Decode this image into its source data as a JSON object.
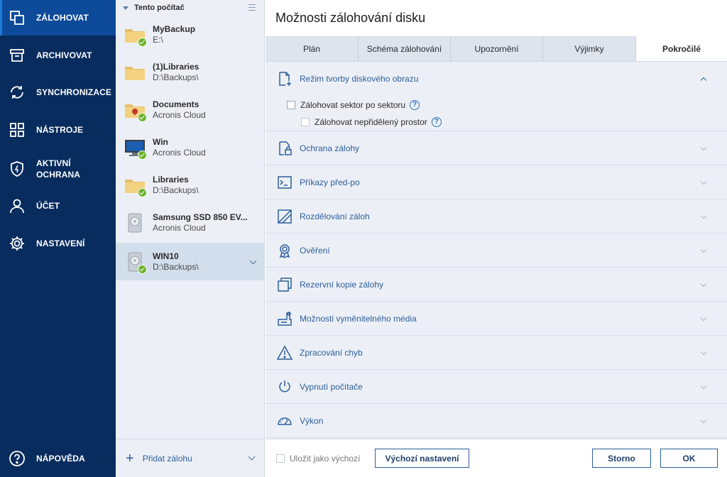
{
  "nav": {
    "items": [
      {
        "label": "ZÁLOHOVAT",
        "icon": "copy-icon",
        "active": true
      },
      {
        "label": "ARCHIVOVAT",
        "icon": "archive-icon"
      },
      {
        "label": "SYNCHRONIZACE",
        "icon": "sync-icon"
      },
      {
        "label": "NÁSTROJE",
        "icon": "grid-icon"
      },
      {
        "label_line1": "AKTIVNÍ",
        "label_line2": "OCHRANA",
        "icon": "shield-icon"
      },
      {
        "label": "ÚČET",
        "icon": "user-icon"
      },
      {
        "label": "NASTAVENÍ",
        "icon": "gear-icon"
      }
    ],
    "help": {
      "label": "NÁPOVĚDA",
      "icon": "help-icon"
    }
  },
  "list": {
    "header": "Tento počítač",
    "items": [
      {
        "name": "MyBackup",
        "dest": "E:\\",
        "icon": "folder-icon"
      },
      {
        "name": "(1)Libraries",
        "dest": "D:\\Backups\\",
        "icon": "folder-icon"
      },
      {
        "name": "Documents",
        "dest": "Acronis Cloud",
        "icon": "folder-lock-icon"
      },
      {
        "name": "Win",
        "dest": "Acronis Cloud",
        "icon": "monitor-icon"
      },
      {
        "name": "Libraries",
        "dest": "D:\\Backups\\",
        "icon": "folder-icon"
      },
      {
        "name": "Samsung SSD 850 EV...",
        "dest": "Acronis Cloud",
        "icon": "disk-icon"
      },
      {
        "name": "WIN10",
        "dest": "D:\\Backups\\",
        "icon": "disk-icon",
        "selected": true
      }
    ],
    "add_label": "Přidat zálohu"
  },
  "main": {
    "title": "Možnosti zálohování disku",
    "tabs": [
      "Plán",
      "Schéma zálohování",
      "Upozornění",
      "Výjimky",
      "Pokročilé"
    ],
    "active_tab": "Pokročilé",
    "sections": [
      {
        "label": "Režim tvorby diskového obrazu",
        "icon": "file-plus-icon",
        "expanded": true
      },
      {
        "label": "Ochrana zálohy",
        "icon": "lock-icon"
      },
      {
        "label": "Příkazy před-po",
        "icon": "terminal-icon"
      },
      {
        "label": "Rozdělování záloh",
        "icon": "split-icon"
      },
      {
        "label": "Ověření",
        "icon": "badge-icon"
      },
      {
        "label": "Rezervní kopie zálohy",
        "icon": "copies-icon"
      },
      {
        "label": "Možnosti vyměnitelného média",
        "icon": "removable-media-icon"
      },
      {
        "label": "Zpracování chyb",
        "icon": "warning-icon"
      },
      {
        "label": "Vypnutí počítače",
        "icon": "power-icon"
      },
      {
        "label": "Výkon",
        "icon": "gauge-icon"
      }
    ],
    "options": {
      "sector_by_sector": "Zálohovat sektor po sektoru",
      "unallocated": "Zálohovat nepřidělený prostor",
      "help_glyph": "?"
    }
  },
  "footer": {
    "save_default": "Uložit jako výchozí",
    "default_settings": "Výchozí nastavení",
    "cancel": "Storno",
    "ok": "OK"
  },
  "colors": {
    "nav_bg": "#082c5e",
    "nav_active": "#0d4b9a",
    "accent": "#2d5d9a",
    "panel_bg": "#ecf0f6",
    "success": "#6ab42b"
  }
}
